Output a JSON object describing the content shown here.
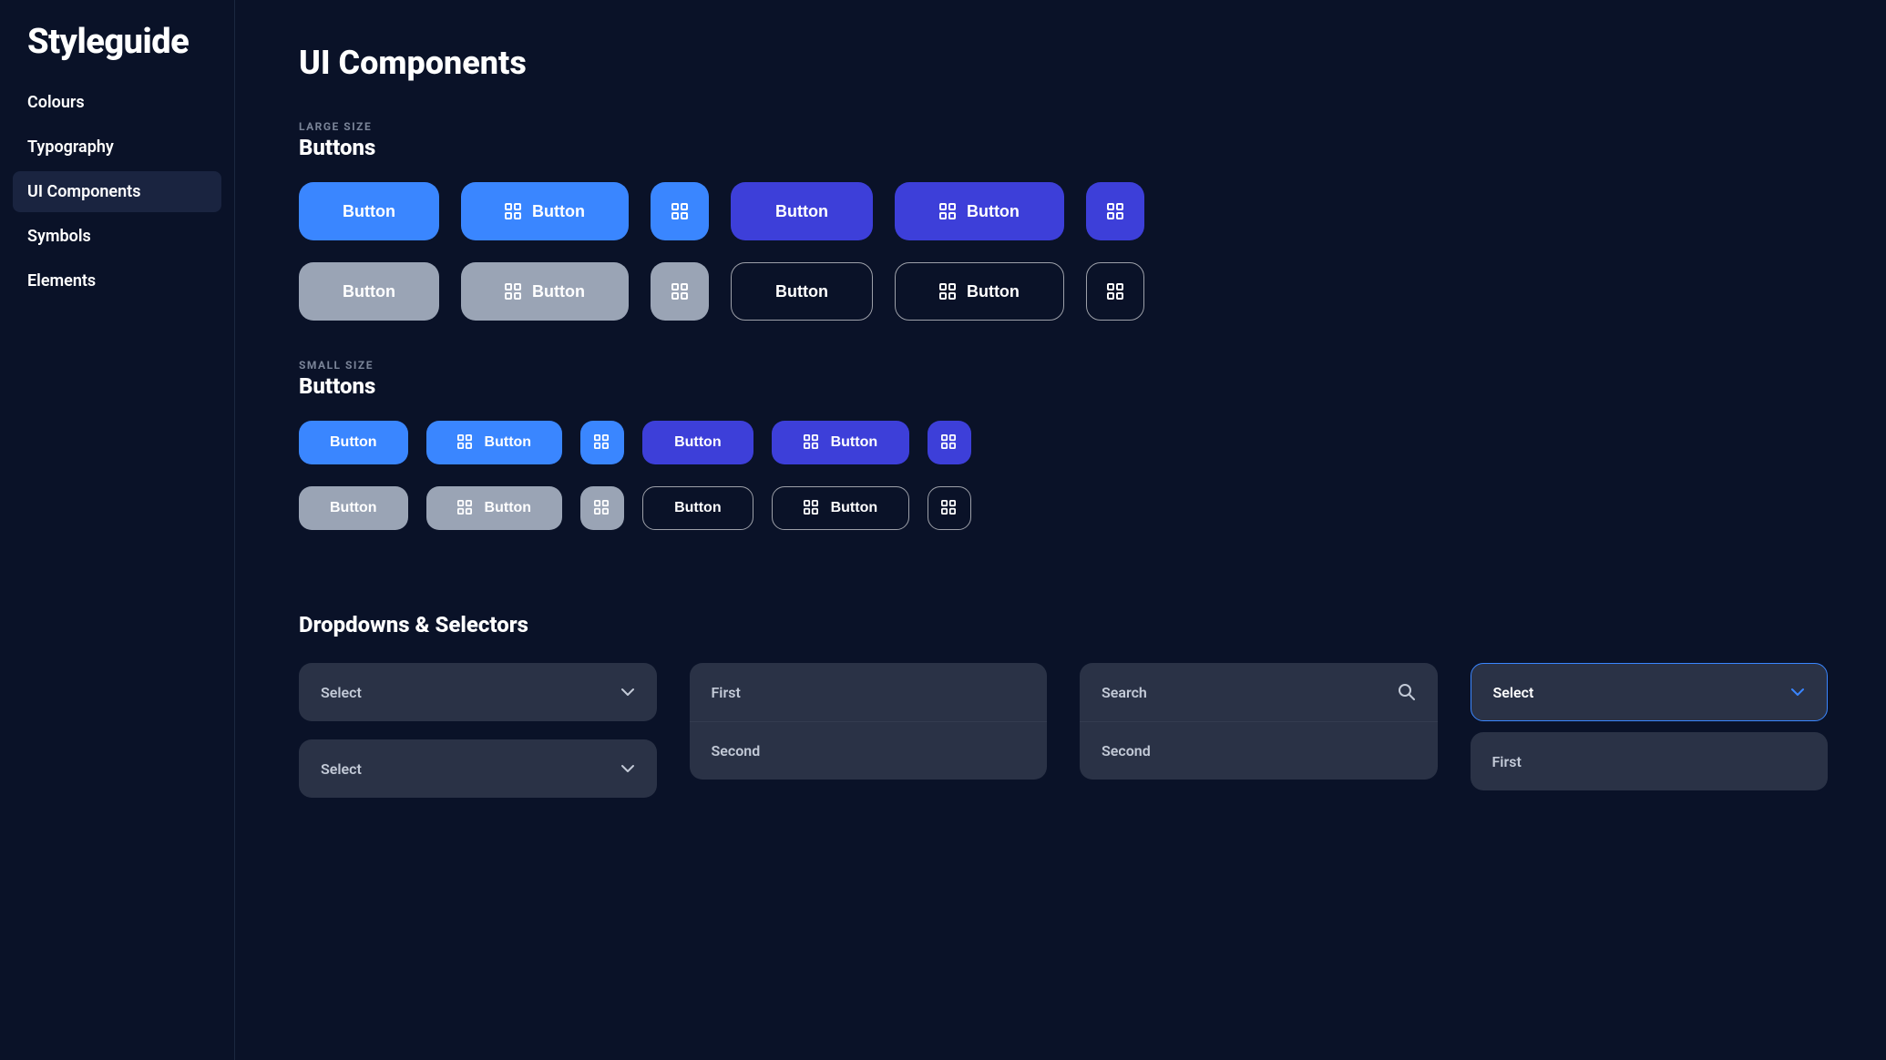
{
  "sidebar": {
    "brand": "Styleguide",
    "items": [
      {
        "label": "Colours",
        "active": false
      },
      {
        "label": "Typography",
        "active": false
      },
      {
        "label": "UI Components",
        "active": true
      },
      {
        "label": "Symbols",
        "active": false
      },
      {
        "label": "Elements",
        "active": false
      }
    ]
  },
  "page": {
    "title": "UI Components"
  },
  "buttons": {
    "large": {
      "overline": "LARGE SIZE",
      "title": "Buttons",
      "label": "Button"
    },
    "small": {
      "overline": "SMALL SIZE",
      "title": "Buttons",
      "label": "Button"
    }
  },
  "dropdowns": {
    "title": "Dropdowns & Selectors",
    "select_label": "Select",
    "list_options": [
      "First",
      "Second"
    ],
    "search_placeholder": "Search",
    "search_list": [
      "Second"
    ],
    "select_focused_label": "Select",
    "select_focused_list": [
      "First"
    ]
  },
  "icons": {
    "grid": "grid-icon",
    "chevron_down": "chevron-down-icon",
    "search": "search-icon"
  }
}
